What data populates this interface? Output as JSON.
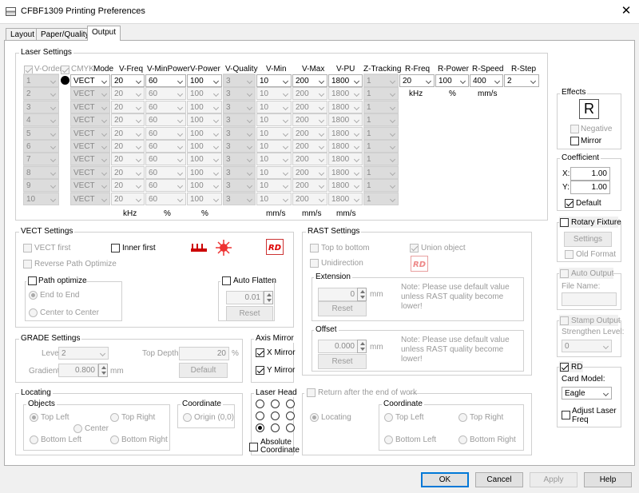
{
  "window": {
    "title": "CFBF1309 Printing Preferences",
    "close": "✕"
  },
  "tabs": [
    {
      "label": "Layout"
    },
    {
      "label": "Paper/Quality"
    },
    {
      "label": "Output"
    }
  ],
  "laser": {
    "group_label": "Laser Settings",
    "headers": {
      "v_order": "V-Order",
      "cmyk": "CMYK",
      "mode": "Mode",
      "v_freq": "V-Freq",
      "v_minpower": "V-MinPower",
      "v_power": "V-Power",
      "v_quality": "V-Quality",
      "v_min": "V-Min",
      "v_max": "V-Max",
      "v_pu": "V-PU",
      "z_tracking": "Z-Tracking",
      "r_freq": "R-Freq",
      "r_power": "R-Power",
      "r_speed": "R-Speed",
      "r_step": "R-Step"
    },
    "rows": [
      {
        "order": "1",
        "mode": "VECT",
        "freq": "20",
        "minpower": "60",
        "power": "100",
        "quality": "3",
        "vmin": "10",
        "vmax": "200",
        "vpu": "1800",
        "z": "1",
        "rfreq": "20",
        "rpower": "100",
        "rspeed": "400",
        "rstep": "2"
      },
      {
        "order": "2",
        "mode": "VECT",
        "freq": "20",
        "minpower": "60",
        "power": "100",
        "quality": "3",
        "vmin": "10",
        "vmax": "200",
        "vpu": "1800",
        "z": "1"
      },
      {
        "order": "3",
        "mode": "VECT",
        "freq": "20",
        "minpower": "60",
        "power": "100",
        "quality": "3",
        "vmin": "10",
        "vmax": "200",
        "vpu": "1800",
        "z": "1"
      },
      {
        "order": "4",
        "mode": "VECT",
        "freq": "20",
        "minpower": "60",
        "power": "100",
        "quality": "3",
        "vmin": "10",
        "vmax": "200",
        "vpu": "1800",
        "z": "1"
      },
      {
        "order": "5",
        "mode": "VECT",
        "freq": "20",
        "minpower": "60",
        "power": "100",
        "quality": "3",
        "vmin": "10",
        "vmax": "200",
        "vpu": "1800",
        "z": "1"
      },
      {
        "order": "6",
        "mode": "VECT",
        "freq": "20",
        "minpower": "60",
        "power": "100",
        "quality": "3",
        "vmin": "10",
        "vmax": "200",
        "vpu": "1800",
        "z": "1"
      },
      {
        "order": "7",
        "mode": "VECT",
        "freq": "20",
        "minpower": "60",
        "power": "100",
        "quality": "3",
        "vmin": "10",
        "vmax": "200",
        "vpu": "1800",
        "z": "1"
      },
      {
        "order": "8",
        "mode": "VECT",
        "freq": "20",
        "minpower": "60",
        "power": "100",
        "quality": "3",
        "vmin": "10",
        "vmax": "200",
        "vpu": "1800",
        "z": "1"
      },
      {
        "order": "9",
        "mode": "VECT",
        "freq": "20",
        "minpower": "60",
        "power": "100",
        "quality": "3",
        "vmin": "10",
        "vmax": "200",
        "vpu": "1800",
        "z": "1"
      },
      {
        "order": "10",
        "mode": "VECT",
        "freq": "20",
        "minpower": "60",
        "power": "100",
        "quality": "3",
        "vmin": "10",
        "vmax": "200",
        "vpu": "1800",
        "z": "1"
      }
    ],
    "units": {
      "freq": "kHz",
      "minpower": "%",
      "power": "%",
      "vmin": "mm/s",
      "vmax": "mm/s",
      "vpu": "mm/s",
      "rfreq": "kHz",
      "rpower": "%",
      "rspeed": "mm/s"
    }
  },
  "effects": {
    "group_label": "Effects",
    "preview": "R",
    "negative": "Negative",
    "mirror": "Mirror"
  },
  "coefficient": {
    "group_label": "Coefficient",
    "x_label": "X:",
    "x_value": "1.00",
    "y_label": "Y:",
    "y_value": "1.00",
    "default": "Default"
  },
  "rotary": {
    "label": "Rotary Fixture",
    "settings": "Settings",
    "old_format": "Old Format"
  },
  "auto_output": {
    "label": "Auto Output",
    "file_name_label": "File Name:",
    "file_name_value": ""
  },
  "stamp": {
    "label": "Stamp Output",
    "strengthen_label": "Strengthen Level:",
    "strengthen_value": "0"
  },
  "rd": {
    "label": "RD",
    "card_model_label": "Card Model:",
    "card_model_value": "Eagle",
    "adjust": "Adjust Laser Freq"
  },
  "vect": {
    "group_label": "VECT Settings",
    "vect_first": "VECT first",
    "inner_first": "Inner first",
    "reverse_path": "Reverse Path Optimize",
    "path_optimize": "Path optimize",
    "end_to_end": "End to End",
    "center_to_center": "Center to Center",
    "auto_flatten": "Auto Flatten",
    "flatten_value": "0.01",
    "reset": "Reset"
  },
  "rast": {
    "group_label": "RAST Settings",
    "top_to_bottom": "Top to bottom",
    "union_object": "Union object",
    "unidirection": "Unidirection",
    "extension_label": "Extension",
    "extension_value": "0",
    "offset_label": "Offset",
    "offset_value": "0.000",
    "unit": "mm",
    "reset": "Reset",
    "note": "Note: Please use default value unless RAST quality become lower!"
  },
  "grade": {
    "group_label": "GRADE Settings",
    "level_label": "Level",
    "level_value": "2",
    "top_depth_label": "Top Depth:",
    "top_depth_value": "20",
    "percent": "%",
    "gradient_label": "Gradient:",
    "gradient_value": "0.800",
    "unit": "mm",
    "default": "Default"
  },
  "axis_mirror": {
    "group_label": "Axis Mirror",
    "x_mirror": "X Mirror",
    "y_mirror": "Y Mirror"
  },
  "locating": {
    "group_label": "Locating",
    "objects_label": "Objects",
    "top_left": "Top Left",
    "top_right": "Top Right",
    "center": "Center",
    "bottom_left": "Bottom Left",
    "bottom_right": "Bottom Right",
    "coordinate_label": "Coordinate",
    "origin": "Origin (0,0)"
  },
  "laser_head": {
    "group_label": "Laser Head",
    "absolute": "Absolute Coordinate"
  },
  "return": {
    "label": "Return after the end of work",
    "locating": "Locating",
    "coordinate_label": "Coordinate",
    "top_left": "Top Left",
    "top_right": "Top Right",
    "bottom_left": "Bottom Left",
    "bottom_right": "Bottom Right"
  },
  "buttons": {
    "ok": "OK",
    "cancel": "Cancel",
    "apply": "Apply",
    "help": "Help"
  }
}
